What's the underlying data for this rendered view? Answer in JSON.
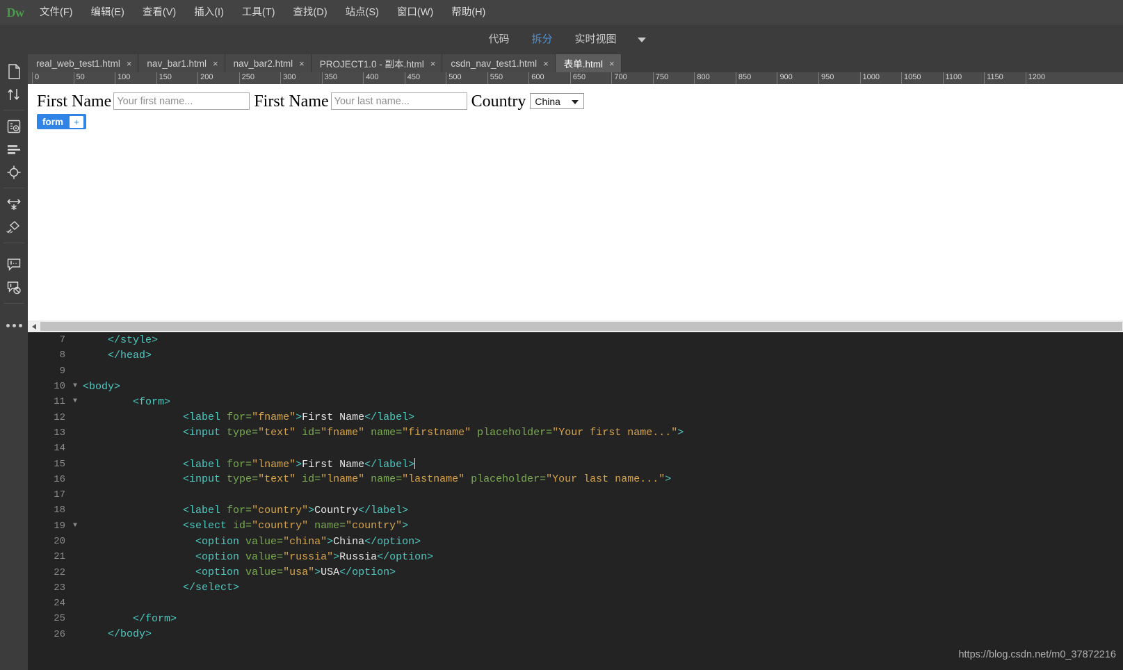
{
  "app": {
    "logo": "Dw",
    "accent_blue": "#4d90d8",
    "badge_blue": "#2f84e5",
    "menubar_bg": "#434343",
    "code_bg": "#232323"
  },
  "menu": {
    "items": [
      {
        "label": "文件(F)"
      },
      {
        "label": "编辑(E)"
      },
      {
        "label": "查看(V)"
      },
      {
        "label": "插入(I)"
      },
      {
        "label": "工具(T)"
      },
      {
        "label": "查找(D)"
      },
      {
        "label": "站点(S)"
      },
      {
        "label": "窗口(W)"
      },
      {
        "label": "帮助(H)"
      }
    ]
  },
  "view_switch": {
    "code_label": "代码",
    "split_label": "拆分",
    "live_label": "实时视图",
    "active": "拆分"
  },
  "tabs": [
    {
      "label": "real_web_test1.html",
      "close": "×",
      "active": false
    },
    {
      "label": "nav_bar1.html",
      "close": "×",
      "active": false
    },
    {
      "label": "nav_bar2.html",
      "close": "×",
      "active": false
    },
    {
      "label": "PROJECT1.0 - 副本.html",
      "close": "×",
      "active": false
    },
    {
      "label": "csdn_nav_test1.html",
      "close": "×",
      "active": false
    },
    {
      "label": "表单.html",
      "close": "×",
      "active": true
    }
  ],
  "ruler": {
    "unit_step": 50,
    "labels": [
      0,
      50,
      100,
      150,
      200,
      250,
      300,
      350,
      400,
      450,
      500,
      550,
      600,
      650,
      700,
      750,
      800,
      850,
      900,
      950,
      1000,
      1050,
      1100,
      1150,
      1200
    ]
  },
  "design_view": {
    "fields": [
      {
        "label": "First Name",
        "placeholder": "Your first name...",
        "type": "text"
      },
      {
        "label": "First Name",
        "placeholder": "Your last name...",
        "type": "text"
      }
    ],
    "select": {
      "label": "Country",
      "selected": "China",
      "options": [
        "China",
        "Russia",
        "USA"
      ]
    },
    "tag_badge": {
      "name": "form",
      "plus": "+"
    }
  },
  "code_view": {
    "lines": [
      {
        "num": "7",
        "fold": "",
        "indent": 2,
        "tokens": [
          {
            "t": "tag",
            "v": "</style>"
          }
        ]
      },
      {
        "num": "8",
        "fold": "",
        "indent": 2,
        "tokens": [
          {
            "t": "tag",
            "v": "</head>"
          }
        ]
      },
      {
        "num": "9",
        "fold": "",
        "indent": 0,
        "tokens": []
      },
      {
        "num": "10",
        "fold": "▼",
        "indent": 0,
        "tokens": [
          {
            "t": "tag",
            "v": "<body>"
          }
        ]
      },
      {
        "num": "11",
        "fold": "▼",
        "indent": 4,
        "tokens": [
          {
            "t": "tag",
            "v": "<form>"
          }
        ]
      },
      {
        "num": "12",
        "fold": "",
        "indent": 8,
        "tokens": [
          {
            "t": "tag",
            "v": "<label "
          },
          {
            "t": "attr",
            "v": "for="
          },
          {
            "t": "val",
            "v": "\"fname\""
          },
          {
            "t": "tag",
            "v": ">"
          },
          {
            "t": "txt",
            "v": "First Name"
          },
          {
            "t": "tag",
            "v": "</label>"
          }
        ]
      },
      {
        "num": "13",
        "fold": "",
        "indent": 8,
        "tokens": [
          {
            "t": "tag",
            "v": "<input "
          },
          {
            "t": "attr",
            "v": "type="
          },
          {
            "t": "val",
            "v": "\"text\""
          },
          {
            "t": "attr",
            "v": " id="
          },
          {
            "t": "val",
            "v": "\"fname\""
          },
          {
            "t": "attr",
            "v": " name="
          },
          {
            "t": "val",
            "v": "\"firstname\""
          },
          {
            "t": "attr",
            "v": " placeholder="
          },
          {
            "t": "val",
            "v": "\"Your first name...\""
          },
          {
            "t": "tag",
            "v": ">"
          }
        ]
      },
      {
        "num": "14",
        "fold": "",
        "indent": 0,
        "tokens": []
      },
      {
        "num": "15",
        "fold": "",
        "indent": 8,
        "tokens": [
          {
            "t": "tag",
            "v": "<label "
          },
          {
            "t": "attr",
            "v": "for="
          },
          {
            "t": "val",
            "v": "\"lname\""
          },
          {
            "t": "tag",
            "v": ">"
          },
          {
            "t": "txt",
            "v": "First Name"
          },
          {
            "t": "tag",
            "v": "</label>"
          },
          {
            "t": "caret",
            "v": ""
          }
        ]
      },
      {
        "num": "16",
        "fold": "",
        "indent": 8,
        "tokens": [
          {
            "t": "tag",
            "v": "<input "
          },
          {
            "t": "attr",
            "v": "type="
          },
          {
            "t": "val",
            "v": "\"text\""
          },
          {
            "t": "attr",
            "v": " id="
          },
          {
            "t": "val",
            "v": "\"lname\""
          },
          {
            "t": "attr",
            "v": " name="
          },
          {
            "t": "val",
            "v": "\"lastname\""
          },
          {
            "t": "attr",
            "v": " placeholder="
          },
          {
            "t": "val",
            "v": "\"Your last name...\""
          },
          {
            "t": "tag",
            "v": ">"
          }
        ]
      },
      {
        "num": "17",
        "fold": "",
        "indent": 0,
        "tokens": []
      },
      {
        "num": "18",
        "fold": "",
        "indent": 8,
        "tokens": [
          {
            "t": "tag",
            "v": "<label "
          },
          {
            "t": "attr",
            "v": "for="
          },
          {
            "t": "val",
            "v": "\"country\""
          },
          {
            "t": "tag",
            "v": ">"
          },
          {
            "t": "txt",
            "v": "Country"
          },
          {
            "t": "tag",
            "v": "</label>"
          }
        ]
      },
      {
        "num": "19",
        "fold": "▼",
        "indent": 8,
        "tokens": [
          {
            "t": "tag",
            "v": "<select "
          },
          {
            "t": "attr",
            "v": "id="
          },
          {
            "t": "val",
            "v": "\"country\""
          },
          {
            "t": "attr",
            "v": " name="
          },
          {
            "t": "val",
            "v": "\"country\""
          },
          {
            "t": "tag",
            "v": ">"
          }
        ]
      },
      {
        "num": "20",
        "fold": "",
        "indent": 9,
        "tokens": [
          {
            "t": "tag",
            "v": "<option "
          },
          {
            "t": "attr",
            "v": "value="
          },
          {
            "t": "val",
            "v": "\"china\""
          },
          {
            "t": "tag",
            "v": ">"
          },
          {
            "t": "txt",
            "v": "China"
          },
          {
            "t": "tag",
            "v": "</option>"
          }
        ]
      },
      {
        "num": "21",
        "fold": "",
        "indent": 9,
        "tokens": [
          {
            "t": "tag",
            "v": "<option "
          },
          {
            "t": "attr",
            "v": "value="
          },
          {
            "t": "val",
            "v": "\"russia\""
          },
          {
            "t": "tag",
            "v": ">"
          },
          {
            "t": "txt",
            "v": "Russia"
          },
          {
            "t": "tag",
            "v": "</option>"
          }
        ]
      },
      {
        "num": "22",
        "fold": "",
        "indent": 9,
        "tokens": [
          {
            "t": "tag",
            "v": "<option "
          },
          {
            "t": "attr",
            "v": "value="
          },
          {
            "t": "val",
            "v": "\"usa\""
          },
          {
            "t": "tag",
            "v": ">"
          },
          {
            "t": "txt",
            "v": "USA"
          },
          {
            "t": "tag",
            "v": "</option>"
          }
        ]
      },
      {
        "num": "23",
        "fold": "",
        "indent": 8,
        "tokens": [
          {
            "t": "tag",
            "v": "</select>"
          }
        ]
      },
      {
        "num": "24",
        "fold": "",
        "indent": 0,
        "tokens": []
      },
      {
        "num": "25",
        "fold": "",
        "indent": 4,
        "tokens": [
          {
            "t": "tag",
            "v": "</form>"
          }
        ]
      },
      {
        "num": "26",
        "fold": "",
        "indent": 2,
        "tokens": [
          {
            "t": "tag",
            "v": "</body>"
          }
        ]
      }
    ]
  },
  "watermark": {
    "text": "https://blog.csdn.net/m0_37872216"
  }
}
